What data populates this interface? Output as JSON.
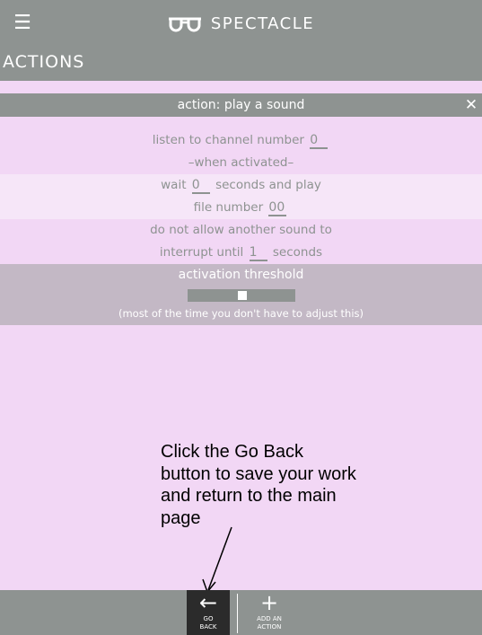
{
  "header": {
    "menu_icon": "hamburger-icon",
    "brand": "SPECTACLE",
    "logo_icon": "spectacle-glasses-icon"
  },
  "page": {
    "title": "ACTIONS"
  },
  "action_panel": {
    "title": "action: play a sound",
    "close_icon": "close-icon",
    "listen_prefix": "listen to channel number",
    "channel_value": "0",
    "when_activated": "–when activated–",
    "wait_prefix": "wait",
    "wait_value": "0",
    "wait_suffix": "seconds and play",
    "file_prefix": "file number",
    "file_value": "00",
    "interrupt_line1": "do not allow another sound to",
    "interrupt_prefix": "interrupt until",
    "interrupt_value": "1",
    "interrupt_suffix": "seconds"
  },
  "threshold": {
    "title": "activation threshold",
    "level": 0.5,
    "note": "(most of the time you don't have to adjust this)"
  },
  "annotation": {
    "text": "Click the Go Back button to save your work and return to the main page"
  },
  "bottom_nav": {
    "go_back_label_1": "GO",
    "go_back_label_2": "BACK",
    "go_back_icon": "arrow-left-icon",
    "add_label_1": "ADD AN",
    "add_label_2": "ACTION",
    "add_icon": "plus-icon"
  }
}
